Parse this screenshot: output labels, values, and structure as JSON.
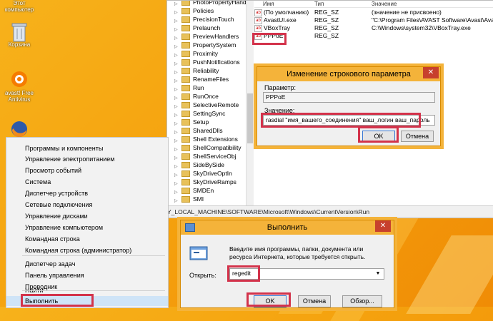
{
  "desktop": {
    "icons": [
      {
        "label": "Этот\nкомпьютер"
      },
      {
        "label": "Корзина"
      },
      {
        "label": "avast! Free\nAntivirus"
      }
    ]
  },
  "regedit": {
    "tree_items": [
      "PhotoPropertyHandler",
      "Policies",
      "PrecisionTouch",
      "Prelaunch",
      "PreviewHandlers",
      "PropertySystem",
      "Proximity",
      "PushNotifications",
      "Reliability",
      "RenameFiles",
      "Run",
      "RunOnce",
      "SelectiveRemote",
      "SettingSync",
      "Setup",
      "SharedDlls",
      "Shell Extensions",
      "ShellCompatibility",
      "ShellServiceObj",
      "SideBySide",
      "SkyDriveOptIn",
      "SkyDriveRamps",
      "SMDEn",
      "SMI"
    ],
    "columns": {
      "name": "Имя",
      "type": "Тип",
      "data": "Значение"
    },
    "rows": [
      {
        "name": "(По умолчанию)",
        "type": "REG_SZ",
        "data": "(значение не присвоено)"
      },
      {
        "name": "AvastUI.exe",
        "type": "REG_SZ",
        "data": "\"C:\\Program Files\\AVAST Software\\Avast\\Ava"
      },
      {
        "name": "VBoxTray",
        "type": "REG_SZ",
        "data": "C:\\Windows\\system32\\VBoxTray.exe"
      },
      {
        "name": "PPPoE",
        "type": "REG_SZ",
        "data": ""
      }
    ],
    "status_path": "Y_LOCAL_MACHINE\\SOFTWARE\\Microsoft\\Windows\\CurrentVersion\\Run"
  },
  "edit_dialog": {
    "title": "Изменение строкового параметра",
    "param_label": "Параметр:",
    "param_value": "PPPoE",
    "value_label": "Значение:",
    "value_text": "rasdial \"имя_вашего_соединения\" ваш_логин ваш_пароль",
    "ok": "OK",
    "cancel": "Отмена",
    "close": "✕"
  },
  "context_menu": {
    "items": [
      "Программы и компоненты",
      "Управление электропитанием",
      "Просмотр событий",
      "Система",
      "Диспетчер устройств",
      "Сетевые подключения",
      "Управление дисками",
      "Управление компьютером",
      "Командная строка",
      "Командная строка (администратор)",
      "Диспетчер задач",
      "Панель управления",
      "Проводник",
      "Найти",
      "Выполнить"
    ]
  },
  "run_dialog": {
    "title": "Выполнить",
    "description": "Введите имя программы, папки, документа или ресурса Интернета, которые требуется открыть.",
    "open_label": "Открыть:",
    "input_value": "regedit",
    "ok": "OK",
    "cancel": "Отмена",
    "browse": "Обзор...",
    "close": "✕"
  },
  "colors": {
    "accent": "#f4b33a",
    "highlight": "#d3334b",
    "close": "#c7402d"
  }
}
